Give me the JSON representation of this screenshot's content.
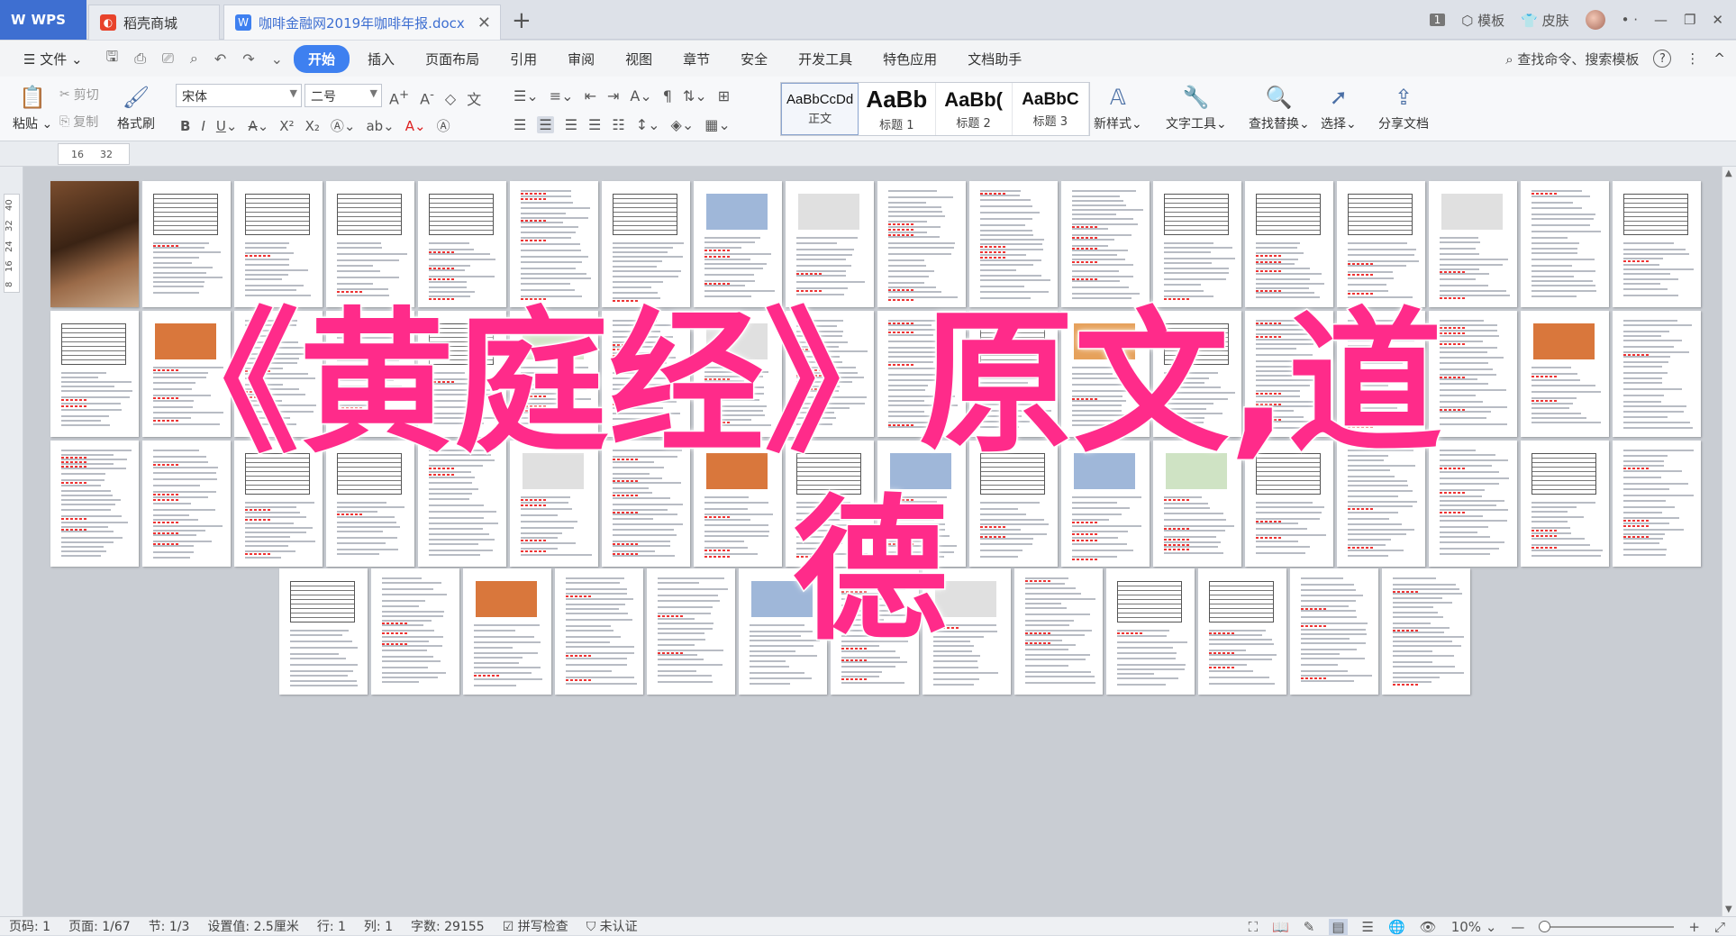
{
  "tabs": {
    "wps": "WPS",
    "shop": "稻壳商城",
    "doc": "咖啡金融网2019年咖啡年报.docx",
    "new_tab": "+"
  },
  "titlebar_right": {
    "count": "1",
    "template": "模板",
    "skin": "皮肤",
    "dots": "•  ·"
  },
  "menu": {
    "file": "文件",
    "items": [
      "开始",
      "插入",
      "页面布局",
      "引用",
      "审阅",
      "视图",
      "章节",
      "安全",
      "开发工具",
      "特色应用",
      "文档助手"
    ],
    "search": "查找命令、搜索模板",
    "help": "?",
    "more": "⋮",
    "collapse": "^"
  },
  "ribbon": {
    "paste": "粘贴",
    "cut": "剪切",
    "copy": "复制",
    "format_painter": "格式刷",
    "font_name": "宋体",
    "font_size": "二号",
    "styles": [
      {
        "sample": "AaBbCcDd",
        "name": "正文"
      },
      {
        "sample": "AaBb",
        "name": "标题 1"
      },
      {
        "sample": "AaBb(",
        "name": "标题 2"
      },
      {
        "sample": "AaBbC",
        "name": "标题 3"
      }
    ],
    "new_style": "新样式",
    "text_tools": "文字工具",
    "find_replace": "查找替换",
    "select": "选择",
    "share": "分享文档"
  },
  "rulers": {
    "top": [
      "16",
      "32"
    ],
    "left": [
      "8",
      "16",
      "24",
      "32",
      "40"
    ]
  },
  "overlay": {
    "line1": "《黄庭经》原文,道",
    "line2": "德"
  },
  "status": {
    "page": "页码: 1",
    "pages": "页面: 1/67",
    "section": "节: 1/3",
    "setting": "设置值: 2.5厘米",
    "row": "行: 1",
    "col": "列: 1",
    "words": "字数: 29155",
    "spell": "拼写检查",
    "auth": "未认证",
    "zoom": "10%"
  }
}
